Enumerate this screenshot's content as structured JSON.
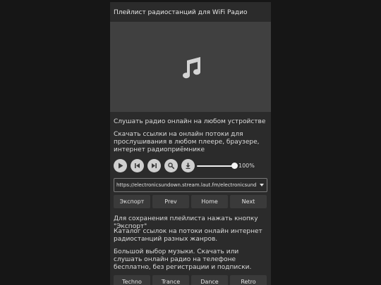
{
  "header": {
    "title": "Плейлист радиостанций для WiFi Радио"
  },
  "cover": {
    "icon": "music-note-icon"
  },
  "intro": {
    "line1": "Слушать радио онлайн на любом устройстве",
    "line2": "Скачать ссылки на онлайн потоки для прослушивания в любом плеере, браузере, интернет радиоприёмнике"
  },
  "player": {
    "buttons": [
      "play-icon",
      "previous-icon",
      "next-icon",
      "search-icon",
      "download-icon"
    ],
    "volume_fraction": 1.0,
    "volume_label": "100%"
  },
  "station_select": {
    "value": "https://electronicsundown.stream.laut.fm/electronicsundown"
  },
  "nav": {
    "export": "Экспорт",
    "prev": "Prev",
    "home": "Home",
    "next": "Next"
  },
  "info": {
    "export_hint": "Для сохранения плейлиста нажать кнопку \"Экспорт\"",
    "catalog": "Каталог ссылок на потоки онлайн интернет радиостанций разных жанров.",
    "choice": "Большой выбор музыки. Скачать или слушать онлайн радио на телефоне бесплатно, без регистрации и подписки."
  },
  "genres": {
    "items": [
      "Techno",
      "Trance",
      "Dance",
      "Retro"
    ]
  },
  "colors": {
    "page_bg": "#161616",
    "panel_bg": "#2b2b2b",
    "cover_bg": "#404040",
    "button_bg": "#3a3a3a",
    "control_bg": "#cfcfcf"
  }
}
